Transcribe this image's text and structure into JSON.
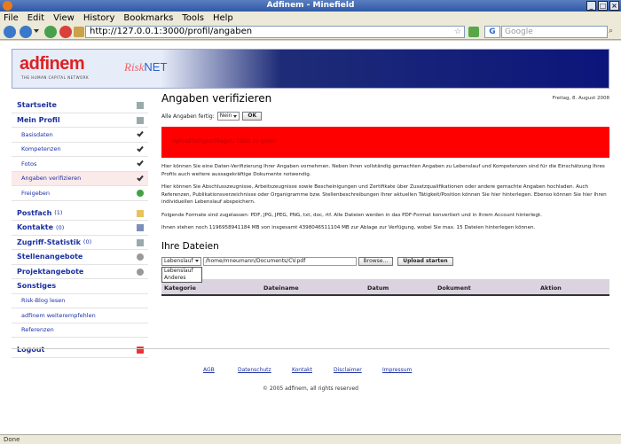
{
  "window": {
    "title": "Adfinem - Minefield"
  },
  "menu": [
    "File",
    "Edit",
    "View",
    "History",
    "Bookmarks",
    "Tools",
    "Help"
  ],
  "nav": {
    "url": "http://127.0.0.1:3000/profil/angaben",
    "search_engine": "G",
    "search_placeholder": "Google",
    "star": "☆"
  },
  "banner": {
    "logo": "adfinem",
    "logo_sub": "THE HUMAN CAPITAL NETWORK",
    "risk": "Risk",
    "net": "NET"
  },
  "sidebar": {
    "items": [
      {
        "label": "Startseite",
        "count": "",
        "icon": "home-icon",
        "sub": false
      },
      {
        "label": "Mein Profil",
        "count": "",
        "icon": "profile-icon",
        "sub": false
      },
      {
        "label": "Basisdaten",
        "count": "",
        "icon": "check-icon",
        "sub": true
      },
      {
        "label": "Kompetenzen",
        "count": "",
        "icon": "check-icon",
        "sub": true
      },
      {
        "label": "Fotos",
        "count": "",
        "icon": "check-icon",
        "sub": true
      },
      {
        "label": "Angaben verifizieren",
        "count": "",
        "icon": "check-icon",
        "sub": true,
        "active": true
      },
      {
        "label": "Freigeben",
        "count": "",
        "icon": "green-circle-icon",
        "sub": true
      },
      {
        "label": "Postfach",
        "count": "(1)",
        "icon": "mail-icon",
        "sub": false
      },
      {
        "label": "Kontakte",
        "count": "(0)",
        "icon": "people-icon",
        "sub": false
      },
      {
        "label": "Zugriff-Statistik",
        "count": "(0)",
        "icon": "stats-icon",
        "sub": false
      },
      {
        "label": "Stellenangebote",
        "count": "",
        "icon": "info-icon",
        "sub": false
      },
      {
        "label": "Projektangebote",
        "count": "",
        "icon": "info-icon",
        "sub": false
      },
      {
        "label": "Sonstiges",
        "count": "",
        "icon": "",
        "sub": false
      },
      {
        "label": "Risk-Blog lesen",
        "count": "",
        "icon": "",
        "sub": true
      },
      {
        "label": "adfinem weiterempfehlen",
        "count": "",
        "icon": "",
        "sub": true
      },
      {
        "label": "Referenzen",
        "count": "",
        "icon": "",
        "sub": true
      },
      {
        "label": "Logout",
        "count": "",
        "icon": "power-icon",
        "sub": false
      }
    ]
  },
  "content": {
    "title": "Angaben verifizieren",
    "date": "Freitag, 8. August 2008",
    "verify_label": "Alle Angaben fertig:",
    "verify_value": "Nein",
    "ok_label": "OK",
    "error": "Upload fehlgeschlagen: Datei zu gross!",
    "paragraphs": [
      "Hier können Sie eine Daten-Verifizierung Ihrer Angaben vornehmen. Neben Ihren vollständig gemachten Angaben zu Lebenslauf und Kompetenzen sind für die Einschätzung Ihres Profils auch weitere aussagekräftige Dokumente notwendig.",
      "Hier können Sie Abschlusszeugnisse, Arbeitszeugnisse sowie Bescheinigungen und Zertifikate über Zusatzqualifikationen oder andere gemachte Angaben hochladen. Auch Referenzen, Publikationsverzeichnisse oder Organigramme bzw. Stellenbeschreibungen Ihrer aktuellen Tätigkeit/Position können Sie hier hinterlegen. Ebenso können Sie hier Ihren individuellen Lebenslauf abspeichern.",
      "Folgende Formate sind zugelassen: PDF, JPG, JPEG, PNG, txt, doc, rtf. Alle Dateien werden in das PDF-Format konvertiert und in Ihrem Account hinterlegt.",
      "Ihnen stehen noch 1196958941184 MB von insgesamt 4398046511104 MB zur Ablage zur Verfügung, wobei Sie max. 15 Dateien hinterlegen können."
    ],
    "files_title": "Ihre Dateien",
    "file_type_value": "Lebenslauf",
    "file_type_options": [
      "Lebenslauf",
      "Anderes"
    ],
    "file_path": "/home/mneumann/Documents/CV.pdf",
    "browse_label": "Browse...",
    "upload_label": "Upload starten",
    "table_headers": [
      "Kategorie",
      "Dateiname",
      "Datum",
      "Dokument",
      "Aktion"
    ]
  },
  "footer": {
    "links": [
      "AGB",
      "Datenschutz",
      "Kontakt",
      "Disclaimer",
      "Impressum"
    ],
    "copyright": "© 2005 adfinem, all rights reserved"
  },
  "status": {
    "text": "Done"
  }
}
